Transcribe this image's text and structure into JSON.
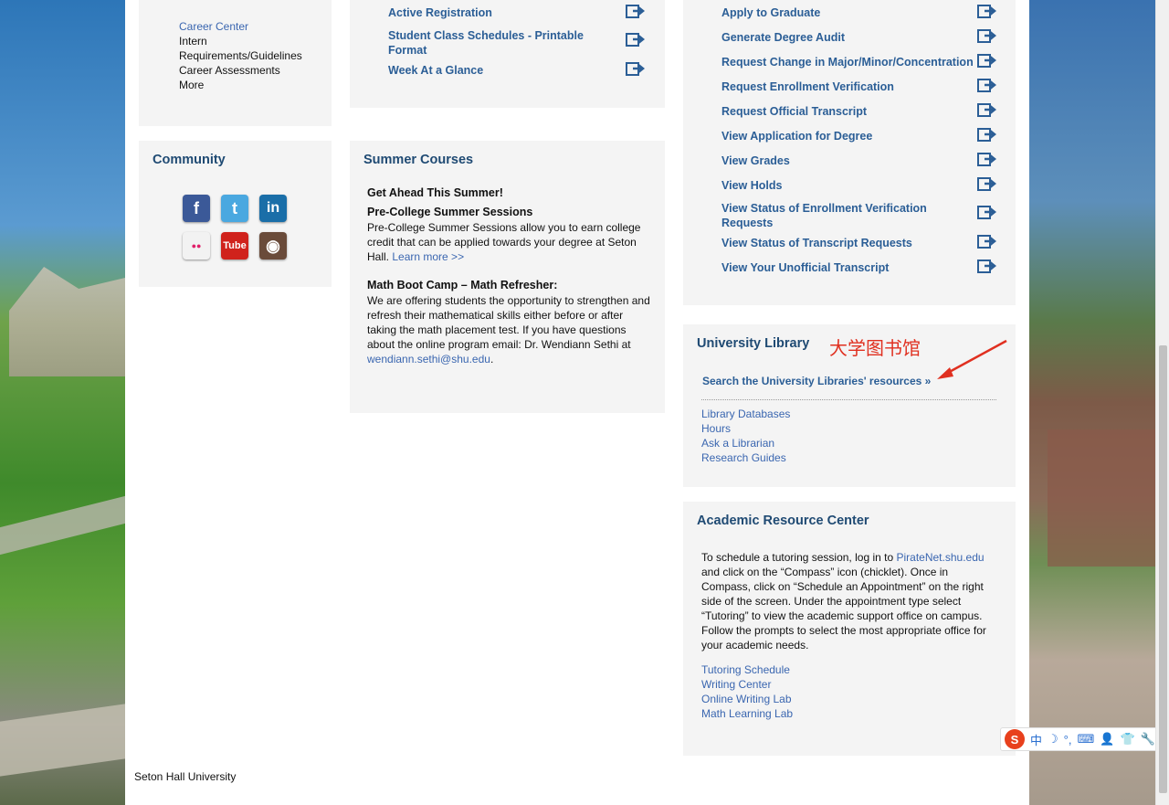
{
  "career": {
    "items": [
      "Career Center",
      "Intern",
      "Requirements/Guidelines",
      "Career Assessments",
      "More"
    ]
  },
  "registration": {
    "links": [
      "Active Registration",
      "Student Class Schedules - Printable Format",
      "Week At a Glance"
    ]
  },
  "records": {
    "links": [
      "Apply to Graduate",
      "Generate Degree Audit",
      "Request Change in Major/Minor/Concentration",
      "Request Enrollment Verification",
      "Request Official Transcript",
      "View Application for Degree",
      "View Grades",
      "View Holds",
      "View Status of Enrollment Verification Requests",
      "View Status of Transcript Requests",
      "View Your Unofficial Transcript"
    ]
  },
  "community": {
    "title": "Community",
    "icons": [
      "facebook-icon",
      "twitter-icon",
      "linkedin-icon",
      "flickr-icon",
      "youtube-icon",
      "instagram-icon"
    ],
    "icon_glyphs": [
      "f",
      "t",
      "in",
      "●●",
      "Tube",
      "◉"
    ]
  },
  "summer": {
    "title": "Summer Courses",
    "headline": "Get Ahead This Summer!",
    "precollege_title": "Pre-College Summer Sessions",
    "precollege_text": "Pre-College Summer Sessions allow you to earn college credit that can be applied towards your degree at Seton Hall.",
    "learn_more": "Learn more >>",
    "bootcamp_title": "Math Boot Camp – Math Refresher:",
    "bootcamp_text": "We are offering students the opportunity to strengthen and refresh their mathematical skills either before or after taking the math placement test.  If you have questions about the online program email: Dr. Wendiann Sethi at",
    "email": "wendiann.sethi@shu.edu",
    "period": "."
  },
  "library": {
    "title": "University Library",
    "annotation": "大学图书馆",
    "search_link": "Search the University Libraries' resources »",
    "links": [
      "Library Databases",
      "Hours",
      "Ask a Librarian",
      "Research Guides"
    ]
  },
  "arc": {
    "title": "Academic Resource Center",
    "text_before": "To schedule a tutoring session, log in to",
    "piratenet": "PirateNet.shu.edu",
    "text_after": "and click on the “Compass” icon (chicklet). Once in Compass, click on “Schedule an Appointment” on the right side of the screen. Under the appointment type select “Tutoring” to view the academic support office on campus. Follow the prompts to select the most appropriate office for your academic needs.",
    "links": [
      "Tutoring Schedule",
      "Writing Center",
      "Online Writing Lab",
      "Math Learning Lab"
    ]
  },
  "footer": {
    "text": "Seton Hall University"
  },
  "ime_toolbar": {
    "items": [
      "S",
      "中",
      "☽",
      "°,",
      "⌨",
      "👤",
      "👕",
      "🔧"
    ]
  }
}
